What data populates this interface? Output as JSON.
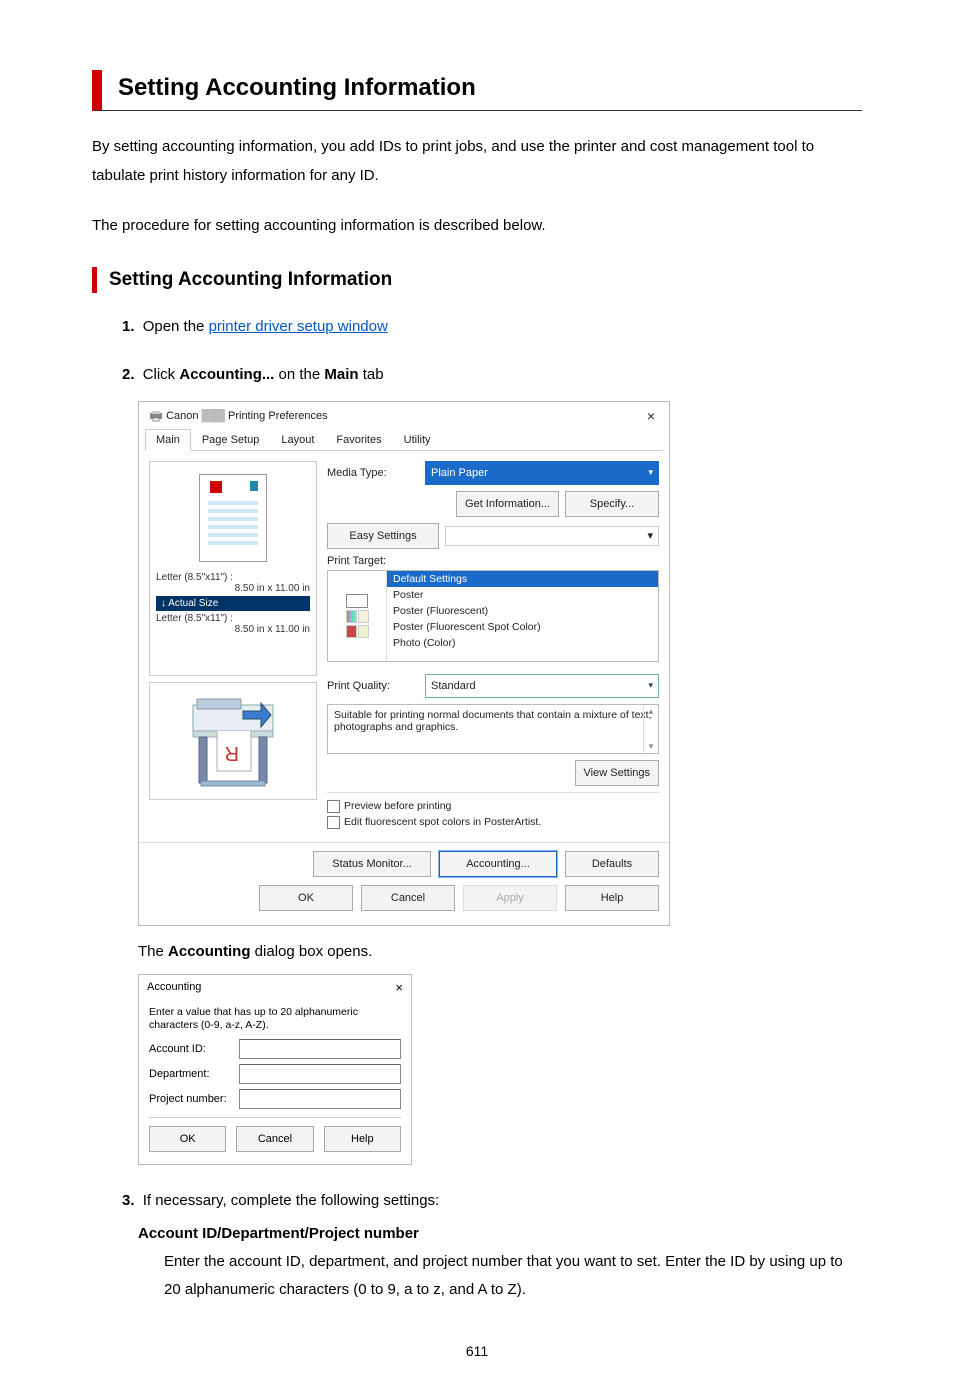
{
  "title": "Setting Accounting Information",
  "intro": "By setting accounting information, you add IDs to print jobs, and use the printer and cost management tool to tabulate print history information for any ID.",
  "intro2": "The procedure for setting accounting information is described below.",
  "subheading": "Setting Accounting Information",
  "steps": {
    "s1": {
      "num": "1.",
      "pre": "Open the ",
      "link": "printer driver setup window"
    },
    "s2": {
      "num": "2.",
      "pre": "Click ",
      "b1": "Accounting...",
      "mid": " on the ",
      "b2": "Main",
      "post": " tab"
    },
    "s2b": {
      "pre": "The ",
      "b": "Accounting",
      "post": " dialog box opens."
    },
    "s3": {
      "num": "3.",
      "text": "If necessary, complete the following settings:"
    }
  },
  "field_desc": {
    "h": "Account ID/Department/Project number",
    "p": "Enter the account ID, department, and project number that you want to set. Enter the ID by using up to 20 alphanumeric characters (0 to 9, a to z, and A to Z)."
  },
  "dlg": {
    "brand": "Canon",
    "title_tail": "Printing Preferences",
    "close": "×",
    "tabs": [
      "Main",
      "Page Setup",
      "Layout",
      "Favorites",
      "Utility"
    ],
    "media_type_lbl": "Media Type:",
    "media_type_val": "Plain Paper",
    "get_info": "Get Information...",
    "specify": "Specify...",
    "easy_lbl": "Easy Settings",
    "print_target_lbl": "Print Target:",
    "targets": [
      "Default Settings",
      "Poster",
      "Poster (Fluorescent)",
      "Poster (Fluorescent Spot Color)",
      "Photo (Color)"
    ],
    "quality_lbl": "Print Quality:",
    "quality_val": "Standard",
    "desc": "Suitable for printing normal documents that contain a mixture of text, photographs and graphics.",
    "view_settings": "View Settings",
    "chk1": "Preview before printing",
    "chk2": "Edit fluorescent spot colors in PosterArtist.",
    "status_monitor": "Status Monitor...",
    "accounting": "Accounting...",
    "defaults": "Defaults",
    "ok": "OK",
    "cancel": "Cancel",
    "apply": "Apply",
    "help": "Help",
    "letter1": "Letter (8.5\"x11\") :",
    "size1": "8.50 in x 11.00 in",
    "actual": "Actual Size",
    "letter2": "Letter (8.5\"x11\") :",
    "size2": "8.50 in x 11.00 in"
  },
  "dlg2": {
    "title": "Accounting",
    "close": "×",
    "hint": "Enter a value that has up to 20 alphanumeric characters (0-9, a-z, A-Z).",
    "account": "Account ID:",
    "dept": "Department:",
    "proj": "Project number:",
    "ok": "OK",
    "cancel": "Cancel",
    "help": "Help"
  },
  "pagenum": "611"
}
